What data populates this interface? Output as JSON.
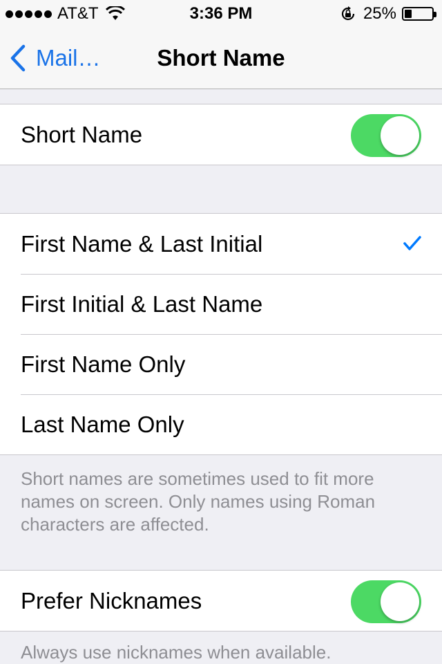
{
  "status": {
    "carrier": "AT&T",
    "time": "3:36 PM",
    "battery_percent": "25%",
    "battery_level": 0.25,
    "signal_bars": 5,
    "wifi_icon": "wifi-icon",
    "rotation_lock_icon": "rotation-lock-icon"
  },
  "nav": {
    "back_label": "Mail…",
    "title": "Short Name"
  },
  "short_name_group": {
    "label": "Short Name",
    "enabled": true
  },
  "options": {
    "items": [
      {
        "label": "First Name & Last Initial",
        "selected": true
      },
      {
        "label": "First Initial & Last Name",
        "selected": false
      },
      {
        "label": "First Name Only",
        "selected": false
      },
      {
        "label": "Last Name Only",
        "selected": false
      }
    ],
    "footer": "Short names are sometimes used to fit more names on screen. Only names using Roman characters are affected."
  },
  "nicknames": {
    "label": "Prefer Nicknames",
    "enabled": true,
    "footer": "Always use nicknames when available."
  },
  "colors": {
    "accent": "#007aff",
    "toggle_on": "#4cd964",
    "background": "#efeff4",
    "footer_text": "#8e8e93"
  }
}
